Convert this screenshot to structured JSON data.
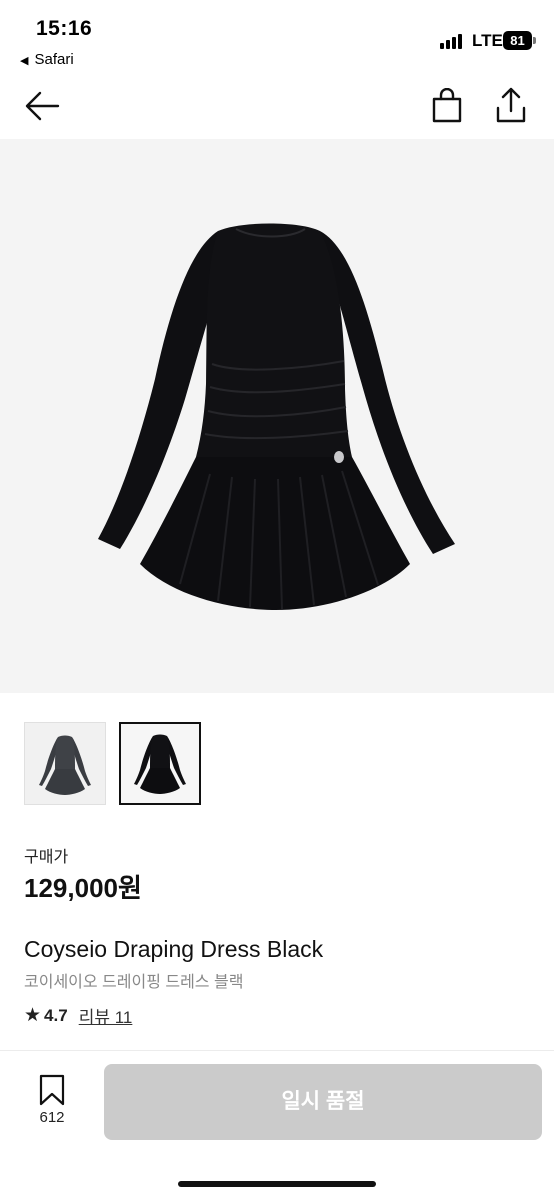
{
  "status_bar": {
    "time": "15:16",
    "back_app": "Safari",
    "back_arrow": "◀",
    "network": "LTE",
    "battery": "81"
  },
  "nav": {
    "back_icon": "arrow-left-icon",
    "bag_icon": "shopping-bag-icon",
    "share_icon": "share-icon"
  },
  "product": {
    "thumbnails": [
      "charcoal-grey-dress",
      "black-dress"
    ],
    "selected_thumbnail": 1,
    "price_label": "구매가",
    "price": "129,000원",
    "name": "Coyseio Draping Dress Black",
    "name_ko": "코이세이오 드레이핑 드레스 블랙",
    "rating_star": "★",
    "rating": "4.7",
    "review_link": "리뷰 11"
  },
  "bottom_bar": {
    "bookmark_count": "612",
    "cta_label": "일시 품절"
  },
  "colors": {
    "hero_bg": "#f4f4f4",
    "cta_disabled": "#cbcbcb",
    "dress_black": "#0f0f12",
    "dress_grey": "#3a3d42"
  }
}
